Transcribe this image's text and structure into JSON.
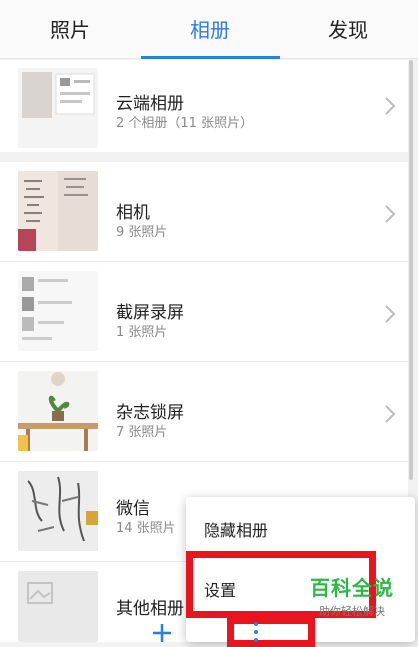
{
  "tabs": [
    {
      "label": "照片"
    },
    {
      "label": "相册"
    },
    {
      "label": "发现"
    }
  ],
  "active_tab_color": "#2a7de1",
  "albums": [
    {
      "name": "云端相册",
      "count": "2 个相册（11 张照片）"
    },
    {
      "name": "相机",
      "count": "9 张照片"
    },
    {
      "name": "截屏录屏",
      "count": "1 张照片"
    },
    {
      "name": "杂志锁屏",
      "count": "7 张照片"
    },
    {
      "name": "微信",
      "count": "14 张照片"
    },
    {
      "name": "其他相册",
      "count": ""
    }
  ],
  "menu": {
    "hide_albums": "隐藏相册",
    "settings": "设置"
  },
  "watermark": {
    "title": "百科全说",
    "subtitle": "助你轻松解决"
  },
  "icons": {
    "add": "plus-icon",
    "more": "more-vertical-icon",
    "chevron": "chevron-right-icon"
  },
  "highlight_color": "#e8141e"
}
